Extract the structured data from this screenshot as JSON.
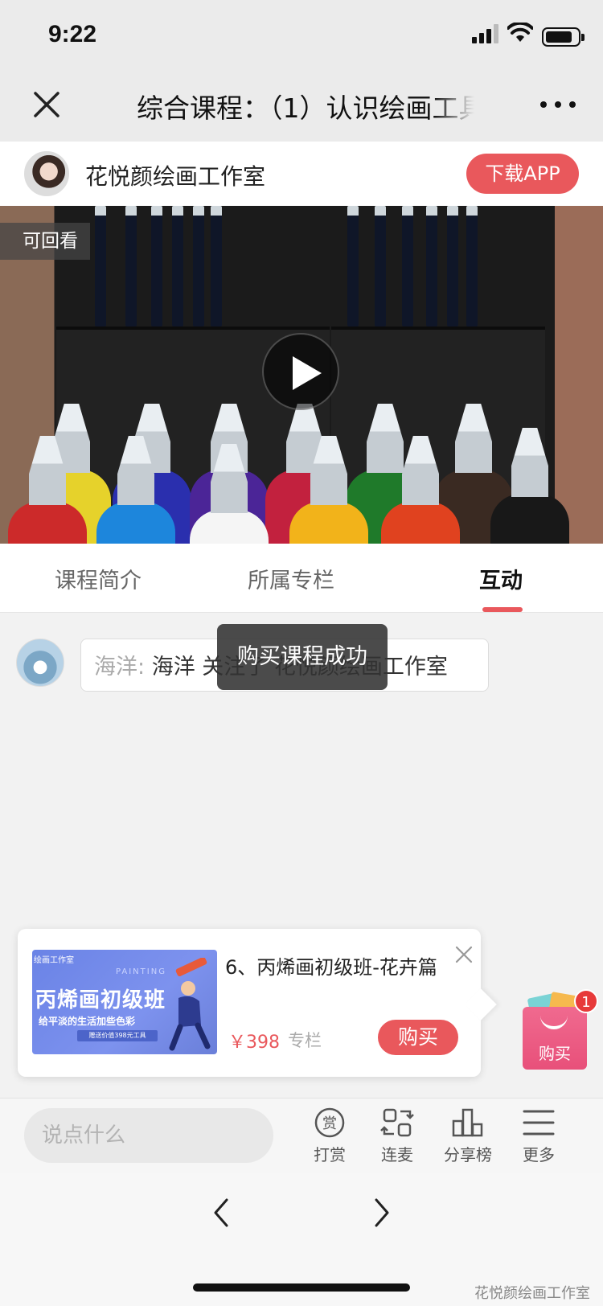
{
  "status_bar": {
    "time": "9:22"
  },
  "nav": {
    "title": "综合课程：（1）认识绘画工具"
  },
  "studio": {
    "name": "花悦颜绘画工作室",
    "download_label": "下载APP"
  },
  "video": {
    "replay_badge": "可回看"
  },
  "tabs": [
    {
      "label": "课程简介",
      "active": false
    },
    {
      "label": "所属专栏",
      "active": false
    },
    {
      "label": "互动",
      "active": true
    }
  ],
  "chat": {
    "user": "海洋:",
    "text": "海洋 关注了 花悦颜绘画工作室"
  },
  "toast": {
    "text": "购买课程成功"
  },
  "product": {
    "title": "6、丙烯画初级班-花卉篇",
    "price": "￥398",
    "tag": "专栏",
    "buy_label": "购买",
    "image": {
      "studio_text": "绘画工作室",
      "painting_text": "PAINTING",
      "title": "丙烯画初级班",
      "slogan": "给平淡的生活加些色彩",
      "gift": "赠送价值398元工具"
    }
  },
  "float_buy": {
    "label": "购买",
    "badge": "1"
  },
  "toolbar": {
    "input_placeholder": "说点什么",
    "items": [
      {
        "label": "打赏",
        "icon": "reward-icon"
      },
      {
        "label": "连麦",
        "icon": "connect-mic-icon"
      },
      {
        "label": "分享榜",
        "icon": "share-rank-icon"
      },
      {
        "label": "更多",
        "icon": "menu-icon"
      }
    ]
  },
  "watermark": "花悦颜绘画工作室",
  "colors": {
    "accent": "#e9585c",
    "float_bag": "#e8507a"
  }
}
